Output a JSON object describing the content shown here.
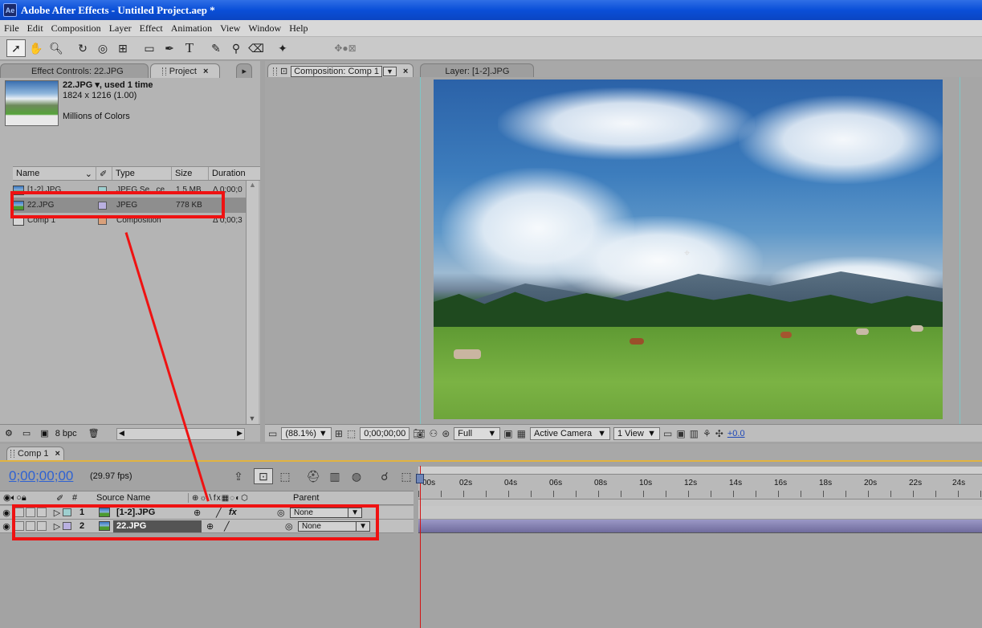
{
  "window": {
    "title": "Adobe After Effects - Untitled Project.aep *",
    "app_icon": "Ae"
  },
  "menu": [
    "File",
    "Edit",
    "Composition",
    "Layer",
    "Effect",
    "Animation",
    "View",
    "Window",
    "Help"
  ],
  "toolbar_icons": [
    "selection-tool-icon",
    "hand-tool-icon",
    "zoom-tool-icon",
    "rotation-tool-icon",
    "orbit-camera-icon",
    "pan-behind-icon",
    "rectangle-mask-icon",
    "pen-tool-icon",
    "type-tool-icon",
    "brush-tool-icon",
    "clone-stamp-icon",
    "eraser-icon",
    "puppet-pin-icon",
    "axis-mode-icons"
  ],
  "left_tabs": {
    "effect_controls": "Effect Controls: 22.JPG",
    "project": "Project"
  },
  "project_info": {
    "name": "22.JPG ▾, used 1 time",
    "dimensions": "1824 x 1216 (1.00)",
    "colors": "Millions of Colors"
  },
  "project_columns": {
    "name": "Name",
    "type": "Type",
    "size": "Size",
    "duration": "Duration"
  },
  "project_items": [
    {
      "name": "[1-2].JPG",
      "type": "JPEG Se...ce",
      "size": "1.5 MB",
      "duration": "Δ 0;00;0",
      "label_color": "#9ecfcf"
    },
    {
      "name": "22.JPG",
      "type": "JPEG",
      "size": "778 KB",
      "duration": "",
      "label_color": "#b9b0e0"
    },
    {
      "name": "Comp 1",
      "type": "Composition",
      "size": "",
      "duration": "Δ 0;00;3",
      "label_color": "#d9a07a"
    }
  ],
  "project_footer": {
    "bpc": "8 bpc"
  },
  "comp_tabs": {
    "composition": "Composition: Comp 1",
    "layer": "Layer: [1-2].JPG"
  },
  "viewer_bar": {
    "zoom": "(88.1%)",
    "timecode": "0;00;00;00",
    "resolution": "Full",
    "camera": "Active Camera",
    "views": "1 View",
    "exposure": "+0.0"
  },
  "timeline": {
    "tab": "Comp 1",
    "timecode": "0;00;00;00",
    "fps": "(29.97 fps)",
    "columns": {
      "number": "#",
      "source_name": "Source Name",
      "parent": "Parent"
    },
    "ruler_labels": [
      "00s",
      "02s",
      "04s",
      "06s",
      "08s",
      "10s",
      "12s",
      "14s",
      "16s",
      "18s",
      "20s",
      "22s",
      "24s"
    ],
    "layers": [
      {
        "index": "1",
        "name": "[1-2].JPG",
        "parent": "None",
        "label_color": "#9ecfcf",
        "fx": "fx"
      },
      {
        "index": "2",
        "name": "22.JPG",
        "parent": "None",
        "label_color": "#b9b0e0",
        "fx": ""
      }
    ]
  },
  "colors": {
    "title_blue": "#0a4fd8",
    "highlight_red": "#ef1212",
    "timecode_blue": "#2f62d2",
    "cti_red": "#d21414",
    "timeline_accent": "#e2b340"
  }
}
